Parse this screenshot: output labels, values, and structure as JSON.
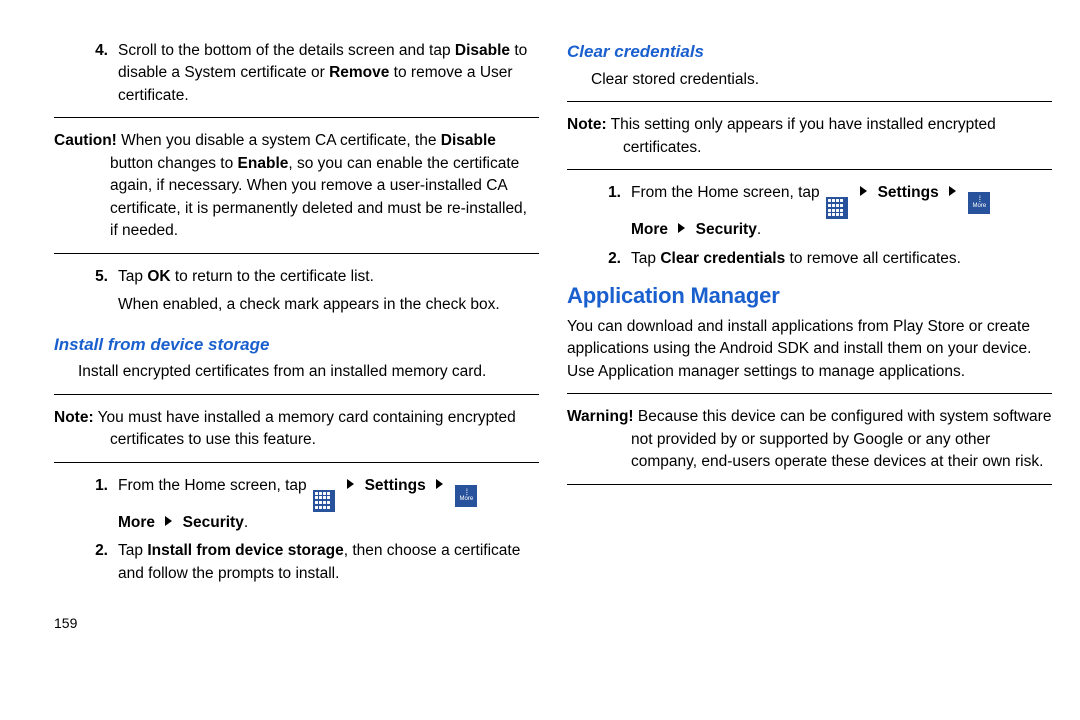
{
  "left": {
    "step4_num": "4.",
    "step4_a": "Scroll to the bottom of the details screen and tap ",
    "step4_b": "Disable",
    "step4_c": " to disable a System certificate or ",
    "step4_d": "Remove",
    "step4_e": " to remove a User certificate.",
    "caution_label": "Caution!",
    "caution_a": " When you disable a system CA certificate, the ",
    "caution_b": "Disable",
    "caution_c": " button changes to ",
    "caution_d": "Enable",
    "caution_e": ", so you can enable the certificate again, if necessary. When you remove a user-installed CA certificate, it is permanently deleted and must be re-installed, if needed.",
    "step5_num": "5.",
    "step5_a": "Tap ",
    "step5_b": "OK",
    "step5_c": " to return to the certificate list.",
    "step5_sub": "When enabled, a check mark appears in the check box.",
    "install_heading": "Install from device storage",
    "install_desc": "Install encrypted certificates from an installed memory card.",
    "install_note_label": "Note:",
    "install_note": " You must have installed a memory card containing encrypted certificates to use this feature.",
    "install_s1_num": "1.",
    "install_s1_a": "From the Home screen, tap ",
    "install_s1_settings": "Settings",
    "install_s1_more": "More",
    "install_s1_security": "Security",
    "install_s2_num": "2.",
    "install_s2_a": "Tap ",
    "install_s2_b": "Install from device storage",
    "install_s2_c": ", then choose a certificate and follow the prompts to install.",
    "page_num": "159"
  },
  "right": {
    "clear_heading": "Clear credentials",
    "clear_desc": "Clear stored credentials.",
    "clear_note_label": "Note:",
    "clear_note": " This setting only appears if you have installed encrypted certificates.",
    "clear_s1_num": "1.",
    "clear_s1_a": "From the Home screen, tap ",
    "clear_s1_settings": "Settings",
    "clear_s1_more": "More",
    "clear_s1_security": "Security",
    "clear_s2_num": "2.",
    "clear_s2_a": "Tap ",
    "clear_s2_b": "Clear credentials",
    "clear_s2_c": " to remove all certificates.",
    "appmgr_heading": "Application Manager",
    "appmgr_desc": "You can download and install applications from Play Store or create applications using the Android SDK and install them on your device. Use Application manager settings to manage applications.",
    "warn_label": "Warning!",
    "warn_text": " Because this device can be configured with system software not provided by or supported by Google or any other company, end-users operate these devices at their own risk."
  },
  "icons": {
    "apps": "apps-icon",
    "more": "more-icon",
    "more_label": "More"
  }
}
